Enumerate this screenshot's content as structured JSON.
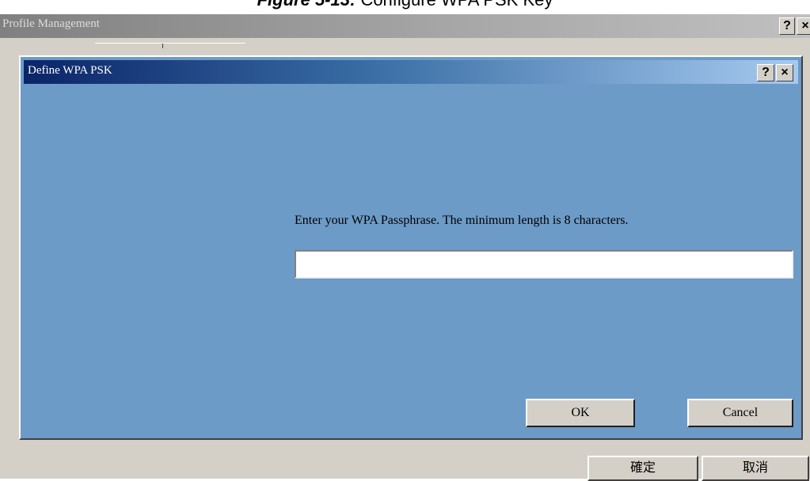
{
  "caption": {
    "figure_label": "Figure 5-13:",
    "text": "Configure WPA PSK Key"
  },
  "outer_window": {
    "title": "Profile Management",
    "help_label": "?",
    "close_label": "×",
    "buttons": {
      "confirm": "確定",
      "cancel": "取消"
    }
  },
  "dialog": {
    "title": "Define WPA PSK",
    "help_label": "?",
    "close_label": "×",
    "prompt": "Enter your WPA Passphrase.  The minimum length is 8 characters.",
    "passphrase": {
      "value": "",
      "placeholder": ""
    },
    "ok_label": "OK",
    "cancel_label": "Cancel"
  },
  "colors": {
    "dialog_body": "#6d9bc7",
    "titlebar_active_start": "#0a2468",
    "titlebar_active_end": "#a6caf0",
    "window_face": "#d4d0c8"
  }
}
